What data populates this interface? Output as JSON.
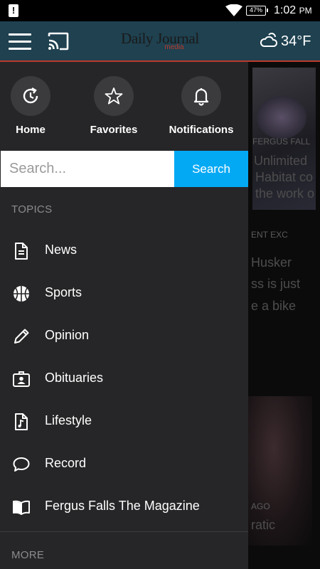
{
  "status_bar": {
    "battery": "47%",
    "time": "1:02",
    "ampm": "PM"
  },
  "app_bar": {
    "logo_line1": "Daily Journal",
    "logo_line2": "media",
    "temperature": "34°F",
    "weather_icon": "cloud-sun-icon"
  },
  "drawer": {
    "quick_links": [
      {
        "label": "Home",
        "icon": "refresh-home-icon"
      },
      {
        "label": "Favorites",
        "icon": "star-icon"
      },
      {
        "label": "Notifications",
        "icon": "bell-icon"
      }
    ],
    "search": {
      "placeholder": "Search...",
      "button": "Search"
    },
    "topics_header": "TOPICS",
    "topics": [
      {
        "label": "News",
        "icon": "document-icon"
      },
      {
        "label": "Sports",
        "icon": "basketball-icon"
      },
      {
        "label": "Opinion",
        "icon": "pencil-icon"
      },
      {
        "label": "Obituaries",
        "icon": "id-badge-icon"
      },
      {
        "label": "Lifestyle",
        "icon": "music-file-icon"
      },
      {
        "label": "Record",
        "icon": "speech-bubble-icon"
      },
      {
        "label": "Fergus Falls The Magazine",
        "icon": "open-book-icon"
      }
    ],
    "more_header": "MORE"
  },
  "background_content": {
    "kicker1": "FERGUS FALL",
    "headline1": [
      "Unlimited",
      "Habitat co",
      "the work o"
    ],
    "kicker2": "ENT EXC",
    "headline2": [
      "Husker",
      "ss is just",
      "e a bike"
    ],
    "kicker3": "AGO",
    "headline3": "ratic"
  },
  "colors": {
    "app_bar": "#1f4150",
    "accent_red": "#b83a2c",
    "drawer_bg": "#262628",
    "search_button": "#04a9f4"
  }
}
